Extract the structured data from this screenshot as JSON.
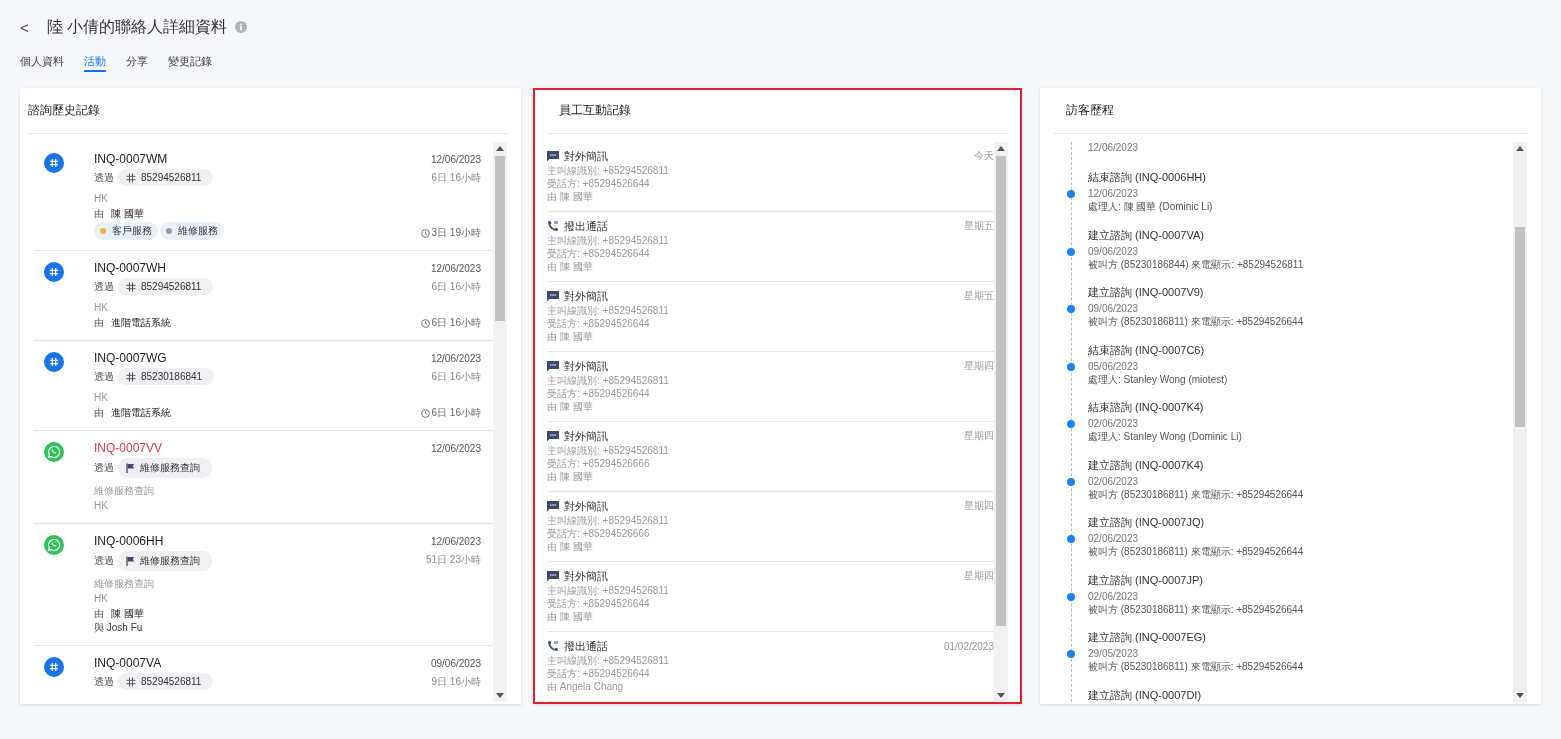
{
  "header": {
    "back": "<",
    "title": "陸 小倩的聯絡人詳細資料"
  },
  "tabs": [
    {
      "label": "個人資料",
      "selected": false
    },
    {
      "label": "活動",
      "selected": true
    },
    {
      "label": "分享",
      "selected": false
    },
    {
      "label": "變更記錄",
      "selected": false
    }
  ],
  "inquiry_panel": {
    "title": "諮詢歷史記錄",
    "highlighted": false,
    "items": [
      {
        "kind": "number",
        "id": "INQ-0007WM",
        "alert": false,
        "via_label": "透過",
        "via": {
          "kind": "number",
          "label": "85294526811"
        },
        "region": "HK",
        "by_label": "由",
        "by": "陳 國華",
        "tags": [
          {
            "label": "客戶服務",
            "color": "#f0b840"
          },
          {
            "label": "維修服務",
            "color": "#9e9e9e"
          }
        ],
        "date": "12/06/2023",
        "age": "6日 16小時",
        "sla": "3日 19小時"
      },
      {
        "kind": "number",
        "id": "INQ-0007WH",
        "alert": false,
        "via_label": "透過",
        "via": {
          "kind": "number",
          "label": "85294526811"
        },
        "region": "HK",
        "by_label": "由",
        "by": "進階電話系統",
        "date": "12/06/2023",
        "age": "6日 16小時",
        "sla": "6日 16小時"
      },
      {
        "kind": "number",
        "id": "INQ-0007WG",
        "alert": false,
        "via_label": "透過",
        "via": {
          "kind": "number",
          "label": "85230186841"
        },
        "region": "HK",
        "by_label": "由",
        "by": "進階電話系統",
        "date": "12/06/2023",
        "age": "6日 16小時",
        "sla": "6日 16小時"
      },
      {
        "kind": "whatsapp",
        "id": "INQ-0007VV",
        "alert": true,
        "via_label": "透過",
        "via": {
          "kind": "flag",
          "label": "維修服務查詢"
        },
        "subject": "維修服務查詢",
        "region": "HK",
        "date": "12/06/2023"
      },
      {
        "kind": "whatsapp",
        "id": "INQ-0006HH",
        "alert": false,
        "via_label": "透過",
        "via": {
          "kind": "flag",
          "label": "維修服務查詢"
        },
        "subject": "維修服務查詢",
        "region": "HK",
        "by_label": "由",
        "by": "陳 國華",
        "with": "與 Josh Fu",
        "date": "12/06/2023",
        "age": "51日 23小時"
      },
      {
        "kind": "number",
        "id": "INQ-0007VA",
        "alert": false,
        "via_label": "透過",
        "via": {
          "kind": "number",
          "label": "85294526811"
        },
        "date": "09/06/2023",
        "age": "9日 16小時"
      }
    ]
  },
  "staff_panel": {
    "title": "員工互動記錄",
    "highlighted": true,
    "items": [
      {
        "kind": "sms",
        "title": "對外簡訊",
        "caller": "主叫線識別: +85294526811",
        "callee": "受話方: +85294526644",
        "by": "由 陳 國華",
        "when": "今天"
      },
      {
        "kind": "call",
        "title": "撥出通話",
        "caller": "主叫線識別: +85294526811",
        "callee": "受話方: +85294526644",
        "by": "由 陳 國華",
        "when": "星期五"
      },
      {
        "kind": "sms",
        "title": "對外簡訊",
        "caller": "主叫線識別: +85294526811",
        "callee": "受話方: +85294526644",
        "by": "由 陳 國華",
        "when": "星期五"
      },
      {
        "kind": "sms",
        "title": "對外簡訊",
        "caller": "主叫線識別: +85294526811",
        "callee": "受話方: +85294526644",
        "by": "由 陳 國華",
        "when": "星期四"
      },
      {
        "kind": "sms",
        "title": "對外簡訊",
        "caller": "主叫線識別: +85294526811",
        "callee": "受話方: +85294526666",
        "by": "由 陳 國華",
        "when": "星期四"
      },
      {
        "kind": "sms",
        "title": "對外簡訊",
        "caller": "主叫線識別: +85294526811",
        "callee": "受話方: +85294526666",
        "by": "由 陳 國華",
        "when": "星期四"
      },
      {
        "kind": "sms",
        "title": "對外簡訊",
        "caller": "主叫線識別: +85294526811",
        "callee": "受話方: +85294526644",
        "by": "由 陳 國華",
        "when": "星期四"
      },
      {
        "kind": "call",
        "title": "撥出通話",
        "caller": "主叫線識別: +85294526811",
        "callee": "受話方: +85294526644",
        "by": "由 Angela Chang",
        "when": "01/02/2023"
      }
    ]
  },
  "journey_panel": {
    "title": "訪客歷程",
    "highlighted": false,
    "items": [
      {
        "date": "12/06/2023"
      },
      {
        "title": "結束諮詢 (INQ-0006HH)",
        "date": "12/06/2023",
        "detail": "處理人: 陳 國華 (Dominic Li)"
      },
      {
        "title": "建立諮詢 (INQ-0007VA)",
        "date": "09/06/2023",
        "detail": "被叫方 (85230186844) 來電顯示: +85294526811"
      },
      {
        "title": "建立諮詢 (INQ-0007V9)",
        "date": "09/06/2023",
        "detail": "被叫方 (85230186811) 來電顯示: +85294526644"
      },
      {
        "title": "結束諮詢 (INQ-0007C6)",
        "date": "05/06/2023",
        "detail": "處理人: Stanley Wong (miotest)"
      },
      {
        "title": "結束諮詢 (INQ-0007K4)",
        "date": "02/06/2023",
        "detail": "處理人: Stanley Wong (Dominic Li)"
      },
      {
        "title": "建立諮詢 (INQ-0007K4)",
        "date": "02/06/2023",
        "detail": "被叫方 (85230186811) 來電顯示: +85294526644"
      },
      {
        "title": "建立諮詢 (INQ-0007JQ)",
        "date": "02/06/2023",
        "detail": "被叫方 (85230186811) 來電顯示: +85294526644"
      },
      {
        "title": "建立諮詢 (INQ-0007JP)",
        "date": "02/06/2023",
        "detail": "被叫方 (85230186811) 來電顯示: +85294526644"
      },
      {
        "title": "建立諮詢 (INQ-0007EG)",
        "date": "29/05/2023",
        "detail": "被叫方 (85230186811) 來電顯示: +85294526644"
      },
      {
        "title": "建立諮詢 (INQ-0007DI)"
      }
    ]
  }
}
